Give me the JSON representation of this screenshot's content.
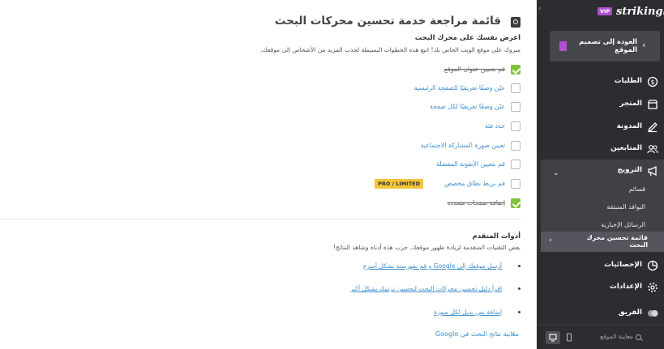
{
  "main": {
    "title": "قائمة مراجعة خدمة تحسين محركات البحث",
    "section1": {
      "heading": "اعرض نفسك على محرك البحث",
      "description": "مبروك على موقع الويب الخاص بك! اتبع هذه الخطوات البسيطة لجذب المزيد من الأشخاص إلى موقعك."
    },
    "checklist": [
      {
        "label": "قم بتعيين عنوان الموقع",
        "done": true
      },
      {
        "label": "عيّن وصفًا تعريفيًا للصفحة الرئيسية",
        "done": false
      },
      {
        "label": "عيّن وصفًا تعريفيًا لكل صفحة",
        "done": false
      },
      {
        "label": "حدد فئة",
        "done": false
      },
      {
        "label": "تعيين صورة المشاركة الاجتماعية",
        "done": false
      },
      {
        "label": "قم بتعيين الأيقونة المفضلة",
        "done": false
      },
      {
        "label": "قم بربط نطاق مخصص",
        "done": false,
        "badge": "PRO / LIMITED"
      },
      {
        "label": "إضافة صفحات متعددة",
        "done": true
      }
    ],
    "section2": {
      "heading": "أدوات المتقدم",
      "description": "بعض التقنيات المتقدمة لزيادة ظهور موقعك. جرب هذه أدناه وشاهد النتائج!"
    },
    "tools": [
      "أرسل موقعك إلى Google و قم بفهرسته بشكل أسرع",
      "اقرأ دليل تحسين محركات البحث لتحسين ترتيبك بشكل أكبر",
      "إضافة نص بديل لكل صورة"
    ],
    "preview_link": "معاينة نتائج البحث في Google",
    "preview_chevron": "‹"
  },
  "sidebar": {
    "collapse": "‹",
    "brand": "strikingly",
    "vip": "VIP",
    "back_label": "العودة إلى تصميم الموقع",
    "back_chevron": "‹",
    "items": [
      {
        "label": "الطلبات",
        "icon": "dollar-circle-icon"
      },
      {
        "label": "المتجر",
        "icon": "store-icon"
      },
      {
        "label": "المدونة",
        "icon": "pen-icon"
      },
      {
        "label": "المتابعين",
        "icon": "users-icon"
      },
      {
        "label": "الترويج",
        "icon": "megaphone-icon"
      },
      {
        "label": "الإحصائيات",
        "icon": "pie-chart-icon"
      },
      {
        "label": "الإعدادات",
        "icon": "gear-icon"
      },
      {
        "label": "الفريق",
        "icon": "team-icon"
      }
    ],
    "promo_chevron": "⌄",
    "sub_items": [
      "قسائم",
      "النوافذ المنبثقة",
      "الرسائل الإخبارية"
    ],
    "active_sub": "قائمة تحسين محرك البحث",
    "active_sub_chevron": "‹",
    "preview_label": "معاينة الموقع"
  }
}
